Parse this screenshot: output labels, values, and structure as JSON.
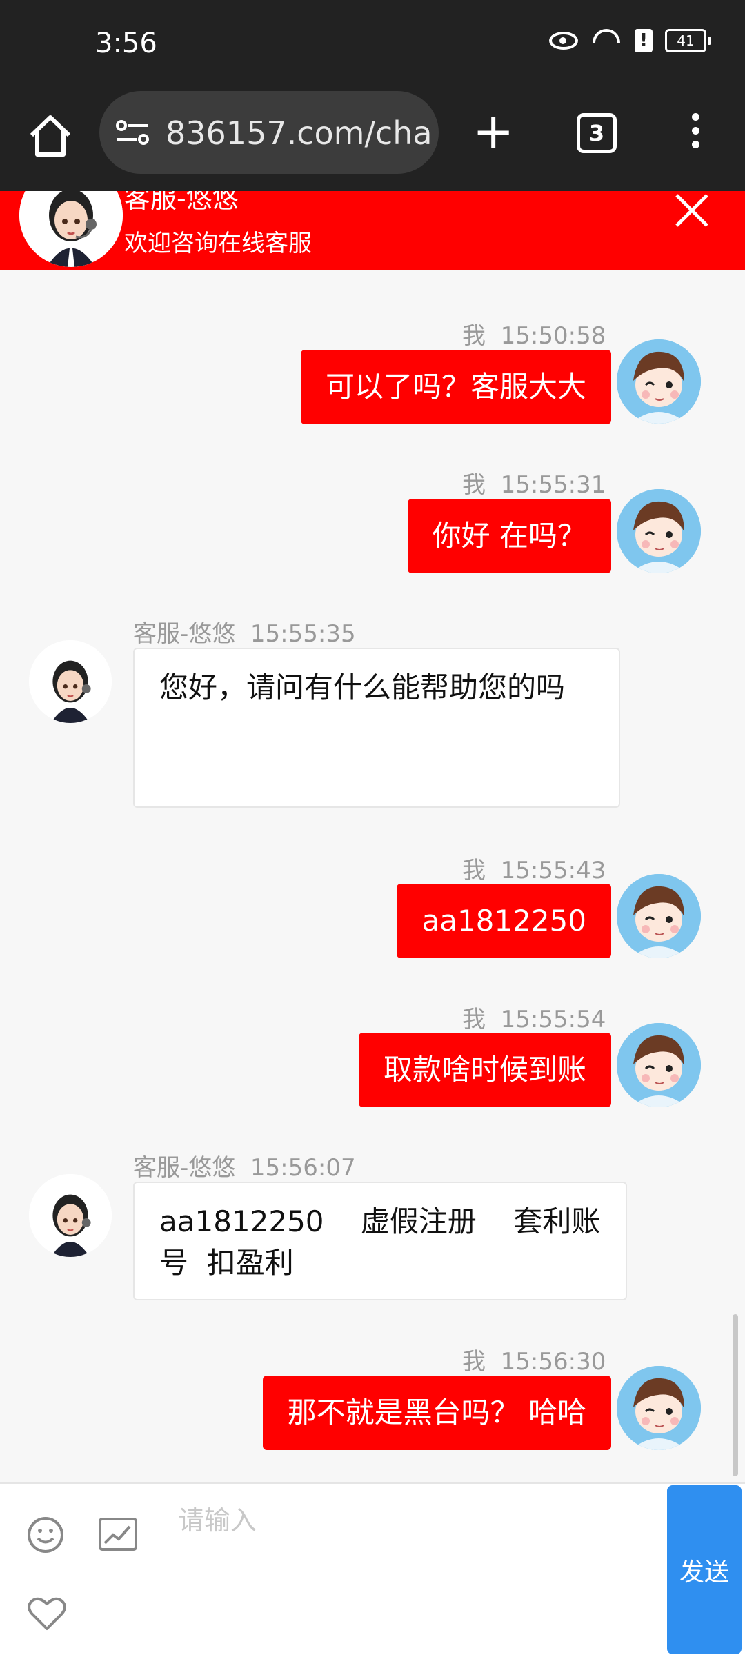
{
  "status_bar": {
    "time": "3:56",
    "battery": "41"
  },
  "browser": {
    "url": "836157.com/chat",
    "tab_count": "3"
  },
  "chat_header": {
    "agent_name": "客服-悠悠",
    "subtitle": "欢迎咨询在线客服"
  },
  "messages": [
    {
      "side": "out",
      "sender": "我",
      "time": "15:50:58",
      "text": "可以了吗？客服大大"
    },
    {
      "side": "out",
      "sender": "我",
      "time": "15:55:31",
      "text": "你好 在吗？"
    },
    {
      "side": "in",
      "sender": "客服-悠悠",
      "time": "15:55:35",
      "text": "您好，请问有什么能帮助您的吗"
    },
    {
      "side": "out",
      "sender": "我",
      "time": "15:55:43",
      "text": "aa1812250"
    },
    {
      "side": "out",
      "sender": "我",
      "time": "15:55:54",
      "text": "取款啥时候到账"
    },
    {
      "side": "in",
      "sender": "客服-悠悠",
      "time": "15:56:07",
      "text": "aa1812250    虚假注册    套利账号  扣盈利"
    },
    {
      "side": "out",
      "sender": "我",
      "time": "15:56:30",
      "text": "那不就是黑台吗？ 哈哈"
    }
  ],
  "input": {
    "placeholder": "请输入",
    "send_label": "发送"
  },
  "colors": {
    "brand_red": "#ff0000",
    "send_blue": "#2f8ff0",
    "chrome_dark": "#222222"
  },
  "icons": [
    "home-icon",
    "site-settings-icon",
    "new-tab-icon",
    "tab-switcher-icon",
    "menu-icon",
    "close-icon",
    "emoji-icon",
    "image-icon",
    "heart-icon"
  ]
}
